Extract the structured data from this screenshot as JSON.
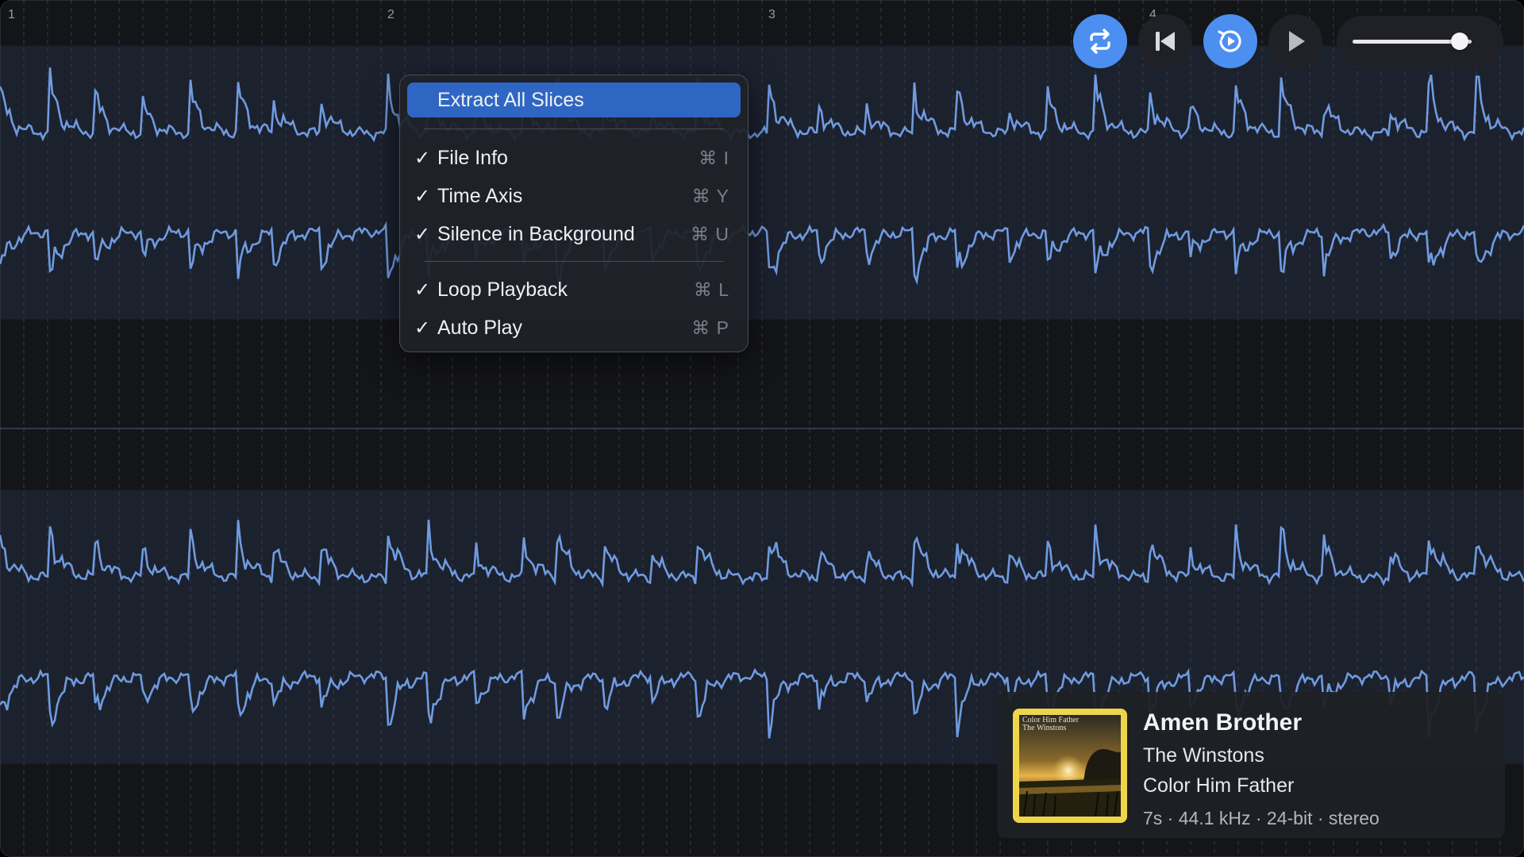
{
  "timeline": {
    "bar_numbers": [
      "1",
      "2",
      "3",
      "4"
    ]
  },
  "transport": {
    "loop_icon": "loop-icon",
    "skip_back_icon": "skip-back-icon",
    "auto_play_icon": "auto-play-icon",
    "play_icon": "play-icon",
    "volume_level": 0.9
  },
  "menu": {
    "primary_item": "Extract All Slices",
    "items": [
      {
        "label": "File Info",
        "shortcut": "⌘ I",
        "checked": "✓"
      },
      {
        "label": "Time Axis",
        "shortcut": "⌘ Y",
        "checked": "✓"
      },
      {
        "label": "Silence in Background",
        "shortcut": "⌘ U",
        "checked": "✓"
      },
      {
        "label": "Loop Playback",
        "shortcut": "⌘ L",
        "checked": "✓"
      },
      {
        "label": "Auto Play",
        "shortcut": "⌘ P",
        "checked": "✓"
      }
    ]
  },
  "file_info": {
    "title": "Amen Brother",
    "artist": "The Winstons",
    "album": "Color Him Father",
    "details": "7s · 44.1 kHz · 24-bit · stereo",
    "cover_text_line1": "Color Him Father",
    "cover_text_line2": "The Winstons"
  },
  "colors": {
    "accent": "#4c8ff0",
    "waveform": "#6f9be0",
    "background": "#141518",
    "cover_border": "#efd54a"
  }
}
